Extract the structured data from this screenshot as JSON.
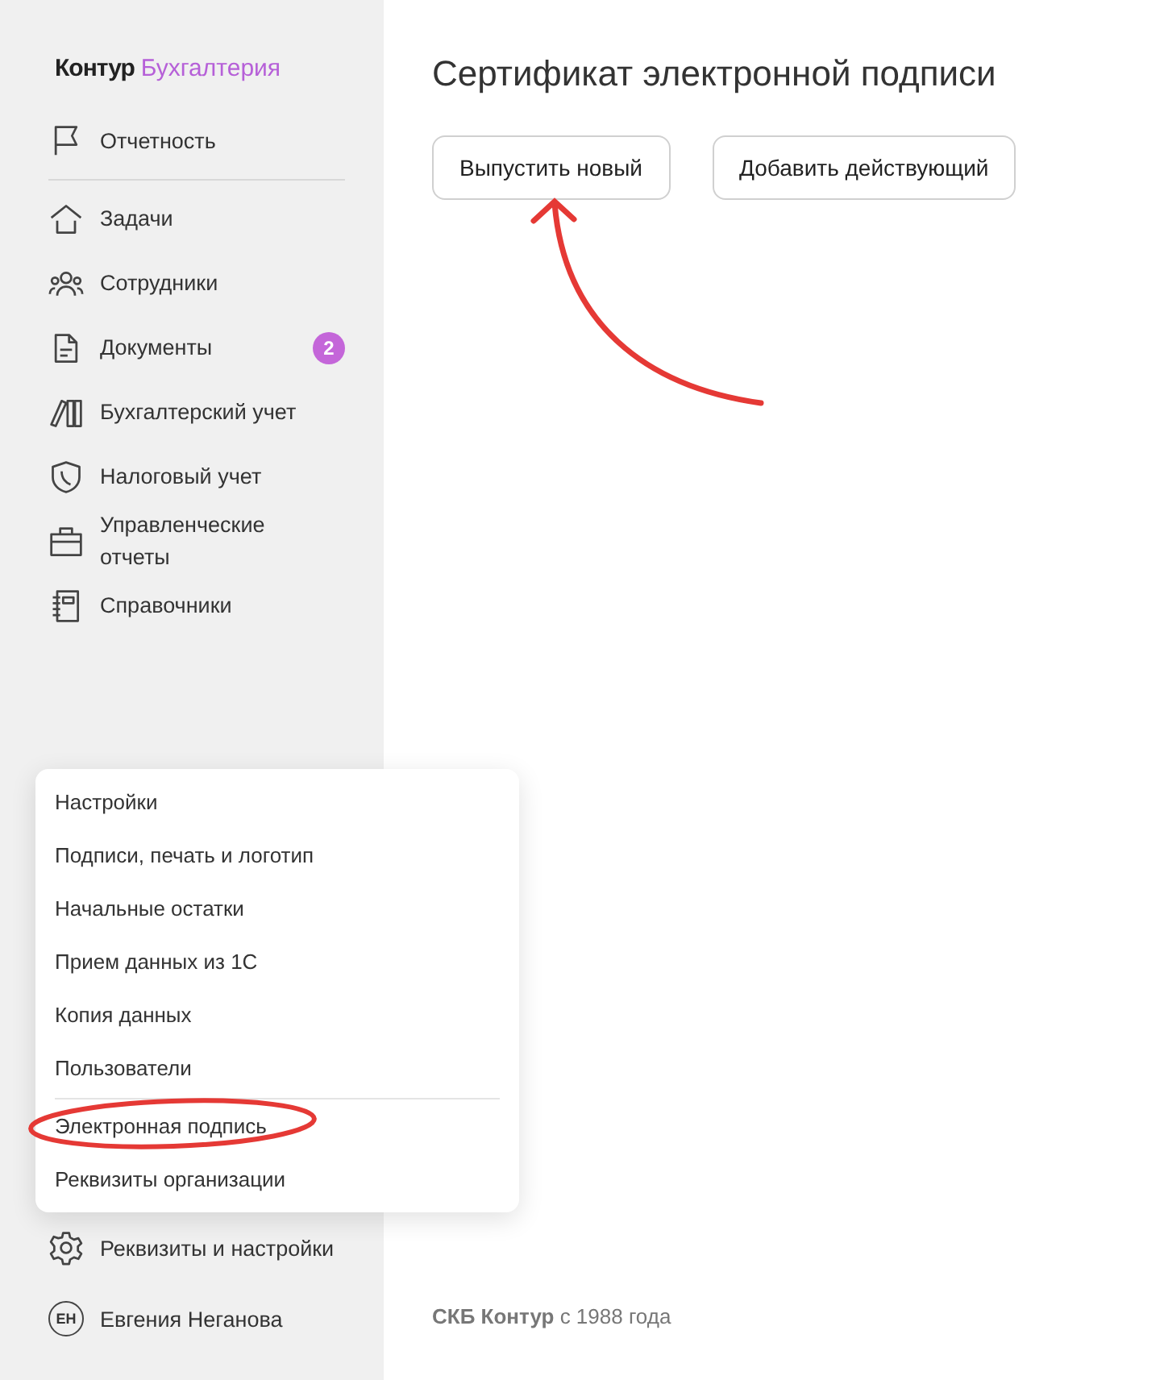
{
  "logo": {
    "brand": "Контур",
    "product": "Бухгалтерия"
  },
  "sidebar": {
    "top_items": [
      {
        "label": "Отчетность"
      }
    ],
    "items": [
      {
        "label": "Задачи"
      },
      {
        "label": "Сотрудники"
      },
      {
        "label": "Документы",
        "badge": "2"
      },
      {
        "label": "Бухгалтерский учет"
      },
      {
        "label": "Налоговый учет"
      },
      {
        "label": "Управленческие отчеты"
      },
      {
        "label": "Справочники"
      }
    ],
    "settings": {
      "label": "Реквизиты и настройки"
    },
    "user": {
      "initials": "ЕН",
      "name": "Евгения Неганова"
    }
  },
  "menu": {
    "groups": [
      {
        "items": [
          "Настройки",
          "Подписи, печать и логотип",
          "Начальные остатки",
          "Прием данных из 1С",
          "Копия данных",
          "Пользователи"
        ]
      },
      {
        "items": [
          "Электронная подпись",
          "Реквизиты организации"
        ]
      }
    ]
  },
  "main": {
    "title": "Сертификат электронной подписи",
    "buttons": [
      "Выпустить новый",
      "Добавить действующий"
    ]
  },
  "footer": {
    "company": "СКБ Контур",
    "since": "с 1988 года"
  }
}
